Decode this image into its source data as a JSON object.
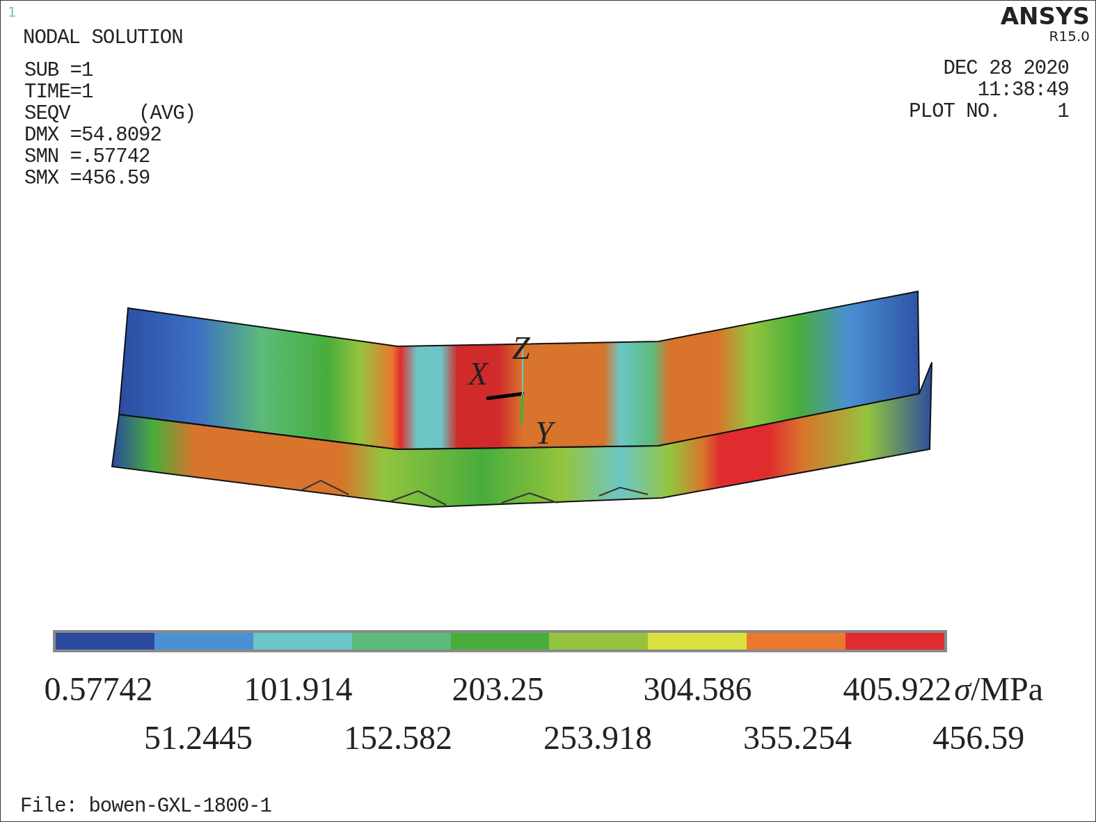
{
  "window_number": "1",
  "title": "NODAL SOLUTION",
  "info_lines": [
    "SUB =1",
    "TIME=1",
    "SEQV      (AVG)",
    "DMX =54.8092",
    "SMN =.57742",
    "SMX =456.59"
  ],
  "logo": {
    "name": "ANSYS",
    "version": "R15.0"
  },
  "plot_info": [
    "DEC 28 2020",
    "11:38:49",
    "PLOT NO.     1"
  ],
  "axes": [
    "X",
    "Z",
    "Y"
  ],
  "legend": {
    "bands": [
      {
        "color": "#2a4b9e"
      },
      {
        "color": "#4a90d2"
      },
      {
        "color": "#6cc6c6"
      },
      {
        "color": "#5cbb7a"
      },
      {
        "color": "#48ad3c"
      },
      {
        "color": "#94c43e"
      },
      {
        "color": "#d9e13c"
      },
      {
        "color": "#e8792e"
      },
      {
        "color": "#e02c2e"
      }
    ],
    "labels": [
      "0.57742",
      "51.2445",
      "101.914",
      "152.582",
      "203.25",
      "253.918",
      "304.586",
      "355.254",
      "405.922",
      "456.59"
    ],
    "unit": "*σ*/MPa"
  },
  "file": "File: bowen-GXL-1800-1"
}
